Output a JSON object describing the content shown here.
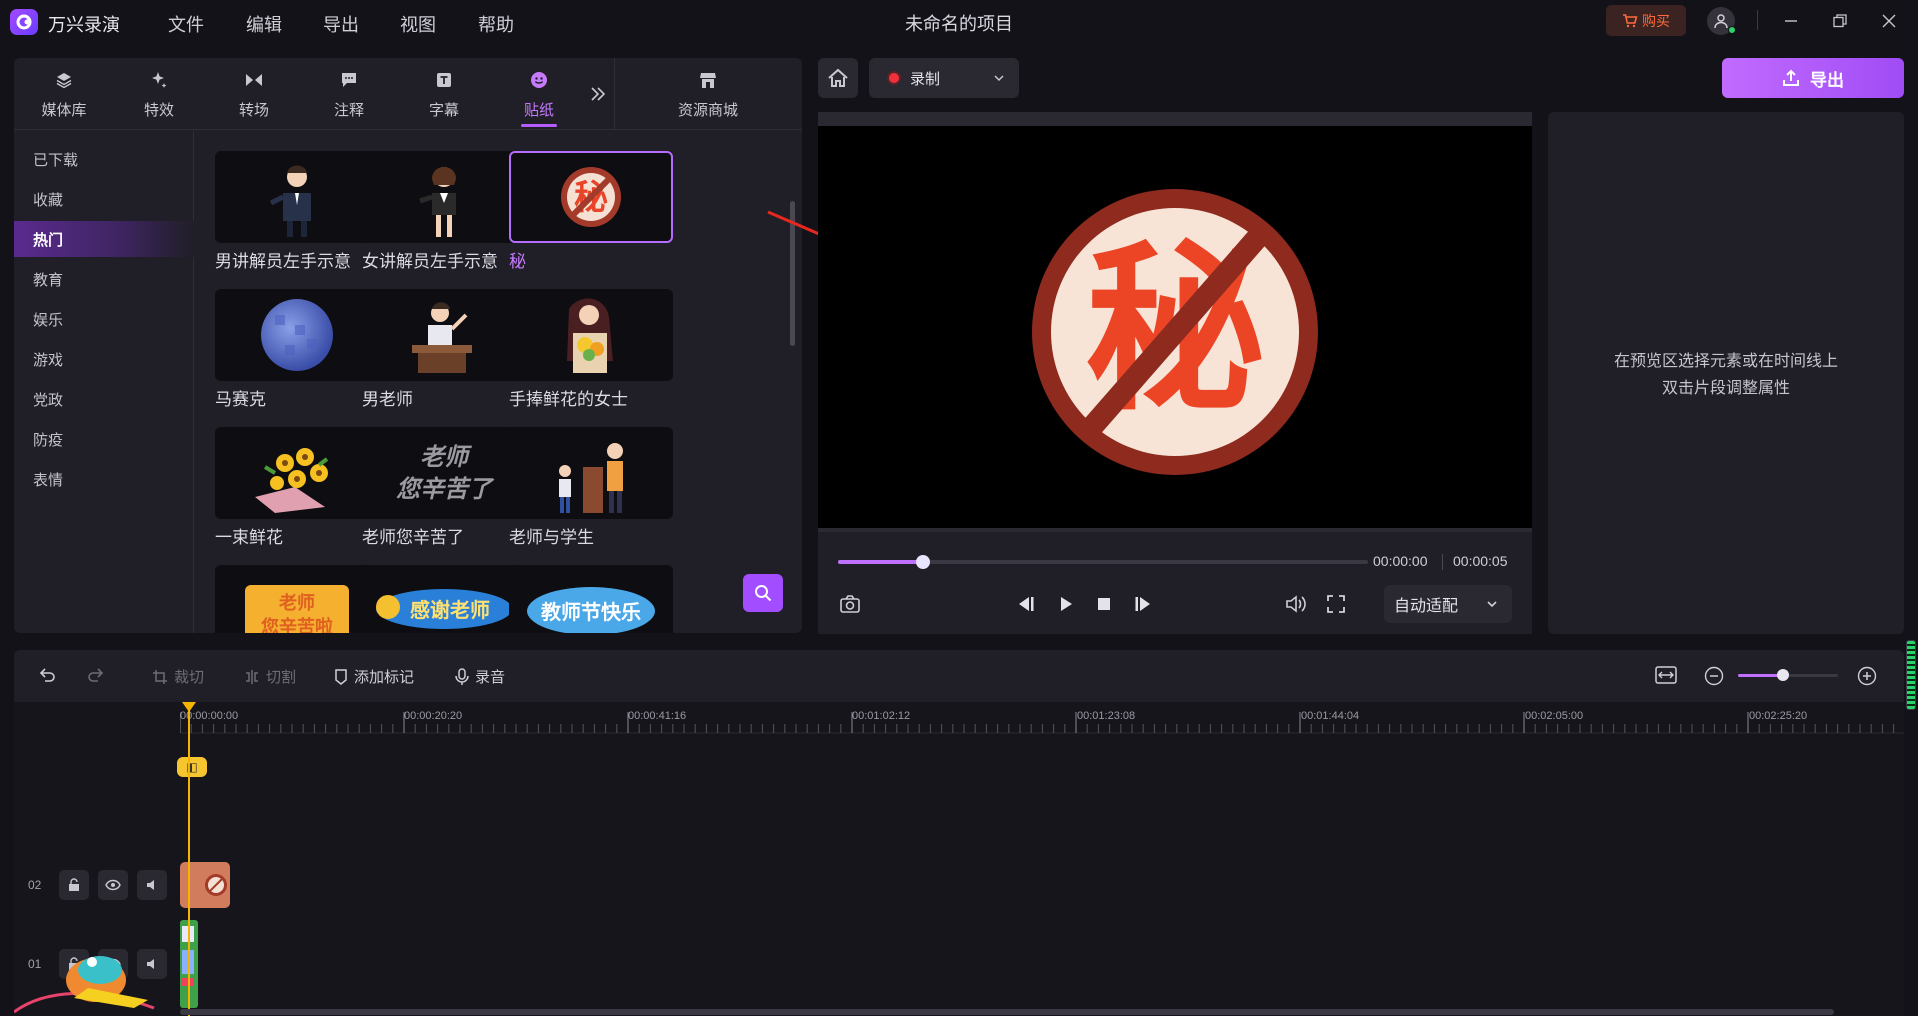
{
  "app": {
    "name": "万兴录演",
    "project_title": "未命名的项目",
    "menu": [
      "文件",
      "编辑",
      "导出",
      "视图",
      "帮助"
    ],
    "buy_label": "购买"
  },
  "left_panel": {
    "tabs": [
      {
        "label": "媒体库",
        "icon": "layers-icon"
      },
      {
        "label": "特效",
        "icon": "sparkle-icon"
      },
      {
        "label": "转场",
        "icon": "transition-icon"
      },
      {
        "label": "注释",
        "icon": "comment-icon"
      },
      {
        "label": "字幕",
        "icon": "text-box-icon"
      },
      {
        "label": "贴纸",
        "icon": "smiley-icon",
        "active": true
      }
    ],
    "store_tab": {
      "label": "资源商城",
      "icon": "store-icon"
    },
    "categories": [
      "已下载",
      "收藏",
      "热门",
      "教育",
      "娱乐",
      "游戏",
      "党政",
      "防疫",
      "表情"
    ],
    "active_category": "热门",
    "stickers": [
      {
        "name": "男讲解员左手示意"
      },
      {
        "name": "女讲解员左手示意"
      },
      {
        "name": "秘",
        "selected": true
      },
      {
        "name": "马赛克"
      },
      {
        "name": "男老师"
      },
      {
        "name": "手捧鲜花的女士"
      },
      {
        "name": "一束鲜花"
      },
      {
        "name": "老师您辛苦了"
      },
      {
        "name": "老师与学生"
      },
      {
        "name": ""
      },
      {
        "name": ""
      },
      {
        "name": ""
      }
    ],
    "sticker_thumb_texts": {
      "secret": "秘",
      "teacher_thanks": "老师\n您辛苦了",
      "row4_a": "老师\n您辛苦啦",
      "row4_b": "感谢老师",
      "row4_c": "教师节快乐"
    }
  },
  "preview": {
    "record_label": "录制",
    "sticker_char": "秘",
    "time_current": "00:00:00",
    "time_total": "00:00:05",
    "progress": 0.16,
    "fit_label": "自动适配"
  },
  "export": {
    "label": "导出"
  },
  "properties": {
    "hint_line1": "在预览区选择元素或在时间线上",
    "hint_line2": "双击片段调整属性"
  },
  "timeline": {
    "tools": {
      "crop": "裁切",
      "split": "切割",
      "add_marker": "添加标记",
      "record_audio": "录音"
    },
    "zoom_level": 0.45,
    "ruler_labels": [
      "00:00:00:00",
      "00:00:20:20",
      "00:00:41:16",
      "00:01:02:12",
      "00:01:23:08",
      "00:01:44:04",
      "00:02:05:00",
      "00:02:25:20"
    ],
    "tracks": [
      {
        "number": "02"
      },
      {
        "number": "01"
      }
    ]
  },
  "colors": {
    "accent": "#b55cff",
    "export_gradient_start": "#c26bff",
    "playhead": "#f4b400",
    "record_dot": "#f0303a"
  }
}
